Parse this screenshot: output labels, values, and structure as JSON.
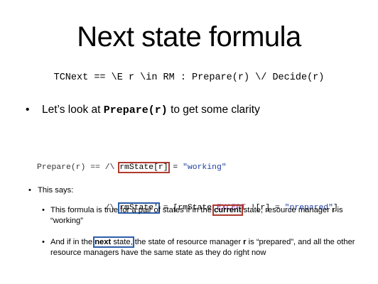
{
  "slide": {
    "title": "Next state formula",
    "formula": "TCNext == \\E r \\in RM : Prepare(r) \\/ Decide(r)",
    "bullet1": {
      "text_before": "Let’s look at ",
      "code": "Prepare(r)",
      "text_after": " to get some clarity"
    },
    "code_block": {
      "line1": {
        "head": "Prepare(r) == /\\ ",
        "boxed": "rmState[r]",
        "eq": " = ",
        "value": "\"working\""
      },
      "line2": {
        "indent": "              /\\ ",
        "boxed": "rmState'",
        "eq": " = ",
        "rest_open": "[rmState ",
        "keyword": "EXCEPT",
        "rest_mid": " ![r] = ",
        "value": "\"prepared\"",
        "rest_close": "]"
      }
    },
    "this_says": "This says:",
    "sub1": {
      "before": "This formula is true for a pair of states if in the ",
      "highlight": "current",
      "after1": " state, resource manager ",
      "bold_r": "r",
      "after2": " is “working”"
    },
    "sub2": {
      "before": "And if in the ",
      "highlight_bold": "next",
      "highlight_rest": " state,",
      "after1": " the state of resource manager ",
      "bold_r": "r",
      "after2": " is “prepared”, and all the other resource managers have the same state as they do right now"
    },
    "colors": {
      "current_box": "#b03a2e",
      "next_box": "#2c5fa8",
      "string_literal": "#1f3fa0",
      "keyword": "#8a2a8a"
    }
  }
}
